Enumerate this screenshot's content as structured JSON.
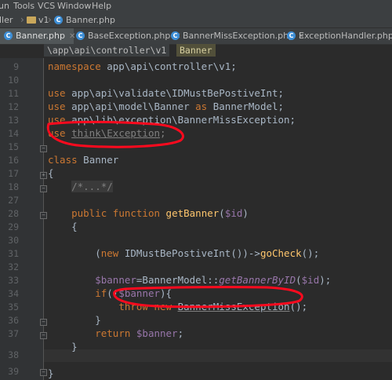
{
  "menu": {
    "items": [
      "un",
      "Tools",
      "VCS",
      "Window",
      "Help"
    ]
  },
  "nav": {
    "segments": [
      "ller",
      "v1",
      "Banner.php"
    ]
  },
  "tabs": [
    {
      "label": "Banner.php",
      "active": true
    },
    {
      "label": "BaseException.php",
      "active": false
    },
    {
      "label": "BannerMissException.php",
      "active": false
    },
    {
      "label": "ExceptionHandler.php",
      "active": false
    }
  ],
  "editor_breadcrumb": {
    "path": "\\app\\api\\controller\\v1",
    "class": "Banner"
  },
  "line_numbers": [
    "9",
    "10",
    "11",
    "12",
    "13",
    "14",
    "15",
    "16",
    "17",
    "18",
    "27",
    "28",
    "29",
    "30",
    "31",
    "32",
    "33",
    "34",
    "35",
    "36",
    "37",
    "38",
    "39"
  ],
  "code": {
    "l9": {
      "kw": "namespace",
      "rest": " app\\api\\controller\\v1;"
    },
    "l11": {
      "kw": "use",
      "rest": " app\\api\\validate\\IDMustBePostiveInt;"
    },
    "l12": {
      "kw": "use",
      "rest_a": " app\\api\\model\\Banner ",
      "kw2": "as",
      "rest_b": " BannerModel;"
    },
    "l13": {
      "kw": "use",
      "rest": " app\\lib\\exception\\BannerMissException;"
    },
    "l14": {
      "kw": "use",
      "space": " ",
      "ns": "think\\Exception",
      "end": ";"
    },
    "l16": {
      "kw": "class",
      "rest": " Banner"
    },
    "l17": {
      "text": "{"
    },
    "l18": {
      "comment": "/*...*/"
    },
    "l27": {
      "kw1": "public",
      "kw2": "function",
      "fn": "getBanner",
      "open": "(",
      "var": "$id",
      "close": ")"
    },
    "l28": {
      "text": "{"
    },
    "l30": {
      "open": "(",
      "kw": "new",
      "rest": " IDMustBePostiveInt())->",
      "fn": "goCheck",
      "end": "();"
    },
    "l32": {
      "var": "$banner",
      "eq": "=BannerModel::",
      "st": "getBannerByID",
      "open": "(",
      "arg": "$id",
      "end": ");"
    },
    "l33": {
      "kw": "if",
      "open": "(!",
      "var": "$banner",
      "end": "){"
    },
    "l34": {
      "kw1": "throw",
      "kw2": "new",
      "cls": "BannerMissException",
      "end": "();"
    },
    "l35": {
      "text": "}"
    },
    "l36": {
      "kw": "return",
      "var": "$banner",
      "end": ";"
    },
    "l37": {
      "text": "}"
    },
    "l39": {
      "text": "}"
    }
  },
  "colors": {
    "background": "#2b2b2b",
    "keyword": "#cc7832",
    "variable": "#9876aa",
    "function": "#ffc66d",
    "annotation_red": "#ff0a1e"
  }
}
